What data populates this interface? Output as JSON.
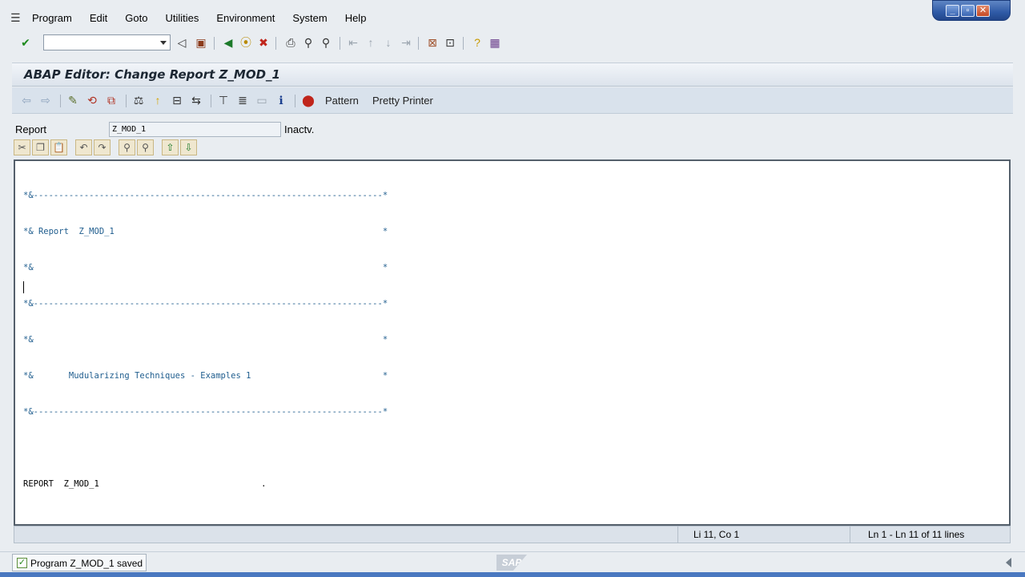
{
  "window": {
    "controls": [
      "minimize-icon",
      "restore-icon",
      "close-icon"
    ]
  },
  "menubar": {
    "items": [
      {
        "label": "Program"
      },
      {
        "label": "Edit"
      },
      {
        "label": "Goto"
      },
      {
        "label": "Utilities"
      },
      {
        "label": "Environment"
      },
      {
        "label": "System"
      },
      {
        "label": "Help"
      }
    ]
  },
  "std_toolbar": {
    "command_field_value": ""
  },
  "header": {
    "title": "ABAP Editor: Change Report Z_MOD_1"
  },
  "app_toolbar": {
    "pattern_label": "Pattern",
    "pretty_printer_label": "Pretty Printer"
  },
  "report": {
    "label": "Report",
    "value": "Z_MOD_1",
    "status": "Inactv."
  },
  "editor": {
    "lines": [
      {
        "text": "*&---------------------------------------------------------------------*",
        "kind": "cmt"
      },
      {
        "text": "*& Report  Z_MOD_1                                                     *",
        "kind": "cmt"
      },
      {
        "text": "*&                                                                     *",
        "kind": "cmt"
      },
      {
        "text": "*&---------------------------------------------------------------------*",
        "kind": "cmt"
      },
      {
        "text": "*&                                                                     *",
        "kind": "cmt"
      },
      {
        "text": "*&       Mudularizing Techniques - Examples 1                          *",
        "kind": "cmt"
      },
      {
        "text": "*&---------------------------------------------------------------------*",
        "kind": "cmt"
      },
      {
        "text": "",
        "kind": "kw"
      },
      {
        "text": "REPORT  Z_MOD_1                                .",
        "kind": "kw"
      },
      {
        "text": "",
        "kind": "kw"
      },
      {
        "text": "",
        "kind": "kw"
      }
    ],
    "position": "Li 11, Co 1",
    "line_range": "Ln 1 - Ln 11 of 11 lines"
  },
  "statusbar": {
    "message": "Program Z_MOD_1 saved",
    "logo_text": "SAP"
  },
  "colors": {
    "comment": "#1f5d8e",
    "background": "#e9edf1",
    "title_bar": "#dce3ec"
  }
}
